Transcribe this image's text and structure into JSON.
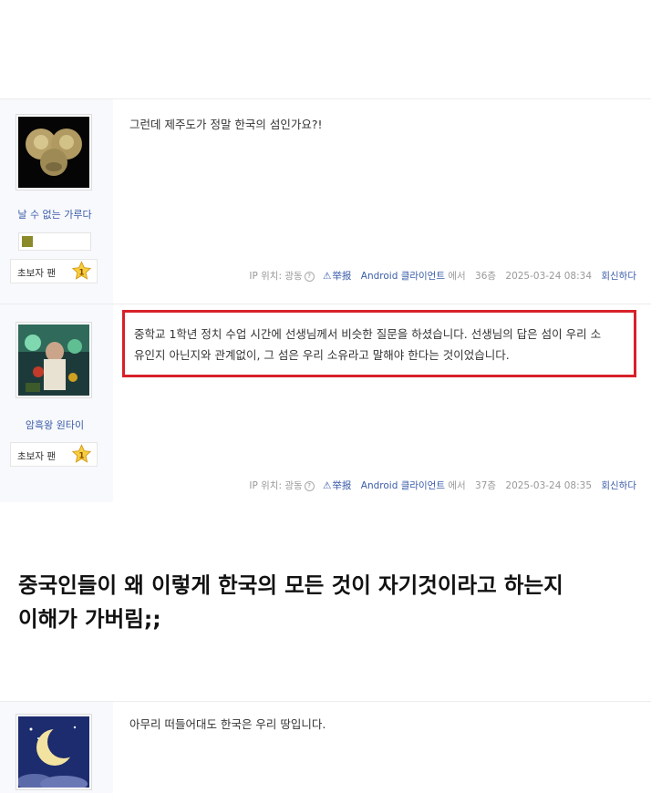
{
  "posts": [
    {
      "username": "날 수 없는 가루다",
      "badge": "초보자 팬",
      "level": "1",
      "text": "그런데 제주도가 정말 한국의 섬인가요?!",
      "meta": {
        "ip_label": "IP 위치: 광동",
        "help_icon": "?",
        "report_icon": "warning-icon",
        "report": "举报",
        "client": "Android 클라이언트",
        "via": "에서",
        "floor": "36층",
        "datetime": "2025-03-24 08:34",
        "reply": "회신하다"
      }
    },
    {
      "username": "암흑왕 원타이",
      "badge": "초보자 팬",
      "level": "1",
      "text_line1": "중학교 1학년 정치 수업 시간에 선생님께서 비슷한 질문을 하셨습니다. 선생님의 답은 섬이 우리 소",
      "text_line2": "유인지 아닌지와 관계없이, 그 섬은 우리 소유라고 말해야 한다는 것이었습니다.",
      "meta": {
        "ip_label": "IP 위치: 광동",
        "help_icon": "?",
        "report_icon": "warning-icon",
        "report": "举报",
        "client": "Android 클라이언트",
        "via": "에서",
        "floor": "37층",
        "datetime": "2025-03-24 08:35",
        "reply": "회신하다"
      }
    },
    {
      "text": "아무리 떠들어대도 한국은 우리 땅입니다."
    }
  ],
  "caption": {
    "line1": "중국인들이 왜 이렇게 한국의 모든 것이 자기것이라고 하는지",
    "line2": "이해가 가버림;;"
  },
  "colors": {
    "highlight_border": "#d8202a",
    "link_blue": "#3a5ca8",
    "sidebar_bg": "#f8f9fc"
  }
}
